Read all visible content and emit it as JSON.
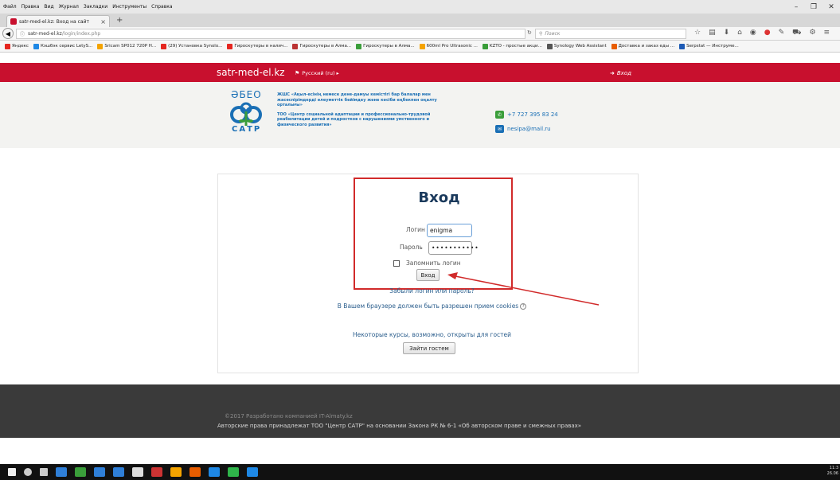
{
  "browser": {
    "menu": [
      "Файл",
      "Правка",
      "Вид",
      "Журнал",
      "Закладки",
      "Инструменты",
      "Справка"
    ],
    "tab_title": "satr-med-el.kz: Вход на сайт",
    "url_host": "satr-med-el.kz",
    "url_path": "/login/index.php",
    "search_placeholder": "Поиск",
    "bookmarks": [
      {
        "label": "Яндекс",
        "color": "#e52620"
      },
      {
        "label": "Кэшбэк сервис LetyS...",
        "color": "#1e88e5"
      },
      {
        "label": "Sricam SP012 720P H...",
        "color": "#f4a300"
      },
      {
        "label": "(29) Установка Synolo...",
        "color": "#e52620"
      },
      {
        "label": "Гироскутеры в налич...",
        "color": "#e52620"
      },
      {
        "label": "Гироскутеры в Алма...",
        "color": "#b33"
      },
      {
        "label": "Гироскутеры в Алма...",
        "color": "#3a9e3a"
      },
      {
        "label": "600ml Pro Ultrasonic ...",
        "color": "#f4a300"
      },
      {
        "label": "KZTO - простые акци...",
        "color": "#3a9e3a"
      },
      {
        "label": "Synology Web Assistant",
        "color": "#555"
      },
      {
        "label": "Доставка и заказ еды ...",
        "color": "#e85d00"
      },
      {
        "label": "Serpstat — Инструме...",
        "color": "#1e5bb5"
      }
    ]
  },
  "site": {
    "name": "satr-med-el.kz",
    "language": "Русский (ru)",
    "login_link": "Вход",
    "logo_top": "ӘБЕО",
    "logo_bottom": "САТР",
    "org_kz": "ЖШС «Ақыл-есінің немесе дене-дамуы кемістігі бар балалар мен жасөспірімдерді әлеуметтік бейімдеу және кәсіби еңбекпен оңалту орталығы»",
    "org_ru": "ТОО «Центр социальной адаптации и профессионально-трудовой реабилитации детей и подростков с нарушениями умственного и физического развития»",
    "phone": "+7 727 395 83 24",
    "email": "nesipa@mail.ru"
  },
  "login": {
    "title": "Вход",
    "username_label": "Логин",
    "username_value": "enigma",
    "password_label": "Пароль",
    "password_value": "•••••••••••",
    "remember_label": "Запомнить логин",
    "submit_label": "Вход",
    "forgot_link": "Забыли логин или пароль?",
    "cookies_note": "В Вашем браузере должен быть разрешен прием cookies",
    "guest_note": "Некоторые курсы, возможно, открыты для гостей",
    "guest_button": "Зайти гостем"
  },
  "footer": {
    "copyright": "©2017 Разработано компанией IT-Almaty.kz",
    "rights": "Авторские права принадлежат ТОО \"Центр САТР\" на основании Закона РК № 6-1 «Об авторском праве и смежных правах»"
  },
  "taskbar": {
    "time": "11:3",
    "date": "26.06",
    "icons": [
      "windows-icon",
      "search-icon",
      "task-view-icon",
      "edge-icon",
      "explorer-icon",
      "store-icon",
      "mail-icon",
      "yandex-icon",
      "firefox-icon",
      "files-icon",
      "skype-icon",
      "whatsapp-icon",
      "app-icon",
      "app2-icon"
    ]
  },
  "colors": {
    "brand_red": "#c8102e",
    "brand_blue": "#1a6fb5",
    "annotation_red": "#d12a2a"
  }
}
